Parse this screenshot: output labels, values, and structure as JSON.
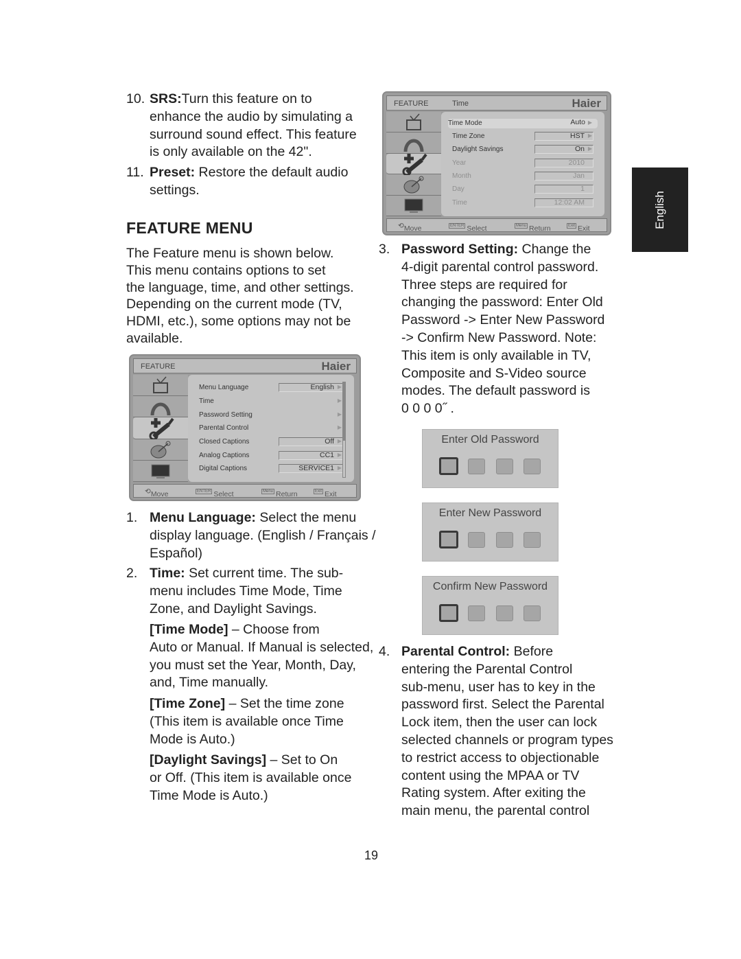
{
  "left_column": {
    "items": [
      {
        "number": "10.",
        "bold": "SRS:",
        "lines": [
          "Turn this feature on to",
          "enhance the audio by simulating a",
          "surround sound effect.  This feature",
          "is only available on the 42\"."
        ]
      },
      {
        "number": "11.",
        "bold": "Preset:",
        "lines": [
          " Restore the default audio",
          "settings."
        ]
      }
    ],
    "heading": "FEATURE MENU",
    "intro": [
      "The Feature menu is shown below.",
      "This menu contains options to set",
      "the language, time, and other settings.",
      "Depending on the current mode (TV,",
      "HDMI, etc.), some options may not be",
      "available."
    ],
    "numbered": [
      {
        "number": "1.",
        "bold": "Menu Language:",
        "lines": [
          " Select the menu",
          "display language. (English / Français /",
          "Español)"
        ]
      },
      {
        "number": "2.",
        "bold": "Time:",
        "lines": [
          " Set current time. The sub-",
          "menu includes Time Mode, Time",
          "Zone, and Daylight Savings."
        ]
      }
    ],
    "sub_items": [
      {
        "bold": "[Time Mode]",
        "lines": [
          " – Choose from",
          "Auto or Manual. If Manual is selected,",
          "you must set the Year, Month, Day,",
          "and, Time manually."
        ]
      },
      {
        "bold": "[Time Zone]",
        "lines": [
          " – Set the time zone",
          "(This item is available once Time",
          "Mode is Auto.)"
        ]
      },
      {
        "bold": "[Daylight Savings]",
        "lines": [
          " – Set to On",
          "or Off. (This item is available once",
          "Time Mode is Auto.)"
        ]
      }
    ]
  },
  "right_column": {
    "numbered": [
      {
        "number": "3.",
        "bold": "Password Setting:",
        "lines": [
          " Change the",
          "4-digit parental control password.",
          "Three steps are required for",
          "changing the password: Enter Old",
          "Password -> Enter New Password",
          "-> Confirm New Password. Note:",
          "This item is only available in TV,",
          "Composite and S-Video source",
          "modes. The default password is",
          "   0 0 0 0˝ ."
        ]
      },
      {
        "number": "4.",
        "bold": "Parental Control:",
        "lines": [
          " Before",
          "entering the Parental Control",
          "sub-menu, user has to key in the",
          "password first. Select the Parental",
          "Lock item, then the user can lock",
          "selected channels or program types",
          "to restrict access to objectionable",
          "content using the MPAA or TV",
          "Rating system.  After exiting the",
          "main menu, the parental control"
        ]
      }
    ],
    "password_dialogs": [
      "Enter Old Password",
      "Enter New Password",
      "Confirm New Password"
    ]
  },
  "feature_menu": {
    "title": "FEATURE",
    "subtitle": "",
    "logo": "Haier",
    "icons": [
      "tv-antenna-icon",
      "sound-arc-icon",
      "wrench-icon",
      "satellite-dish-icon",
      "screen-icon"
    ],
    "selected_icon": 2,
    "rows": [
      {
        "label": "Menu Language",
        "value": "English",
        "box": true,
        "arrow": true
      },
      {
        "label": "Time",
        "value": "",
        "box": false,
        "arrow": true
      },
      {
        "label": "Password Setting",
        "value": "",
        "box": false,
        "arrow": true
      },
      {
        "label": "Parental Control",
        "value": "",
        "box": false,
        "arrow": true
      },
      {
        "label": "Closed Captions",
        "value": "Off",
        "box": true,
        "arrow": true
      },
      {
        "label": "Analog Captions",
        "value": "CC1",
        "box": true,
        "arrow": true
      },
      {
        "label": "Digital Captions",
        "value": "SERVICE1",
        "box": true,
        "arrow": true
      }
    ],
    "footer": [
      {
        "key": "",
        "label": "Move"
      },
      {
        "key": "ENTER",
        "label": "Select"
      },
      {
        "key": "Menu",
        "label": "Return"
      },
      {
        "key": "Exit",
        "label": "Exit"
      }
    ]
  },
  "time_menu": {
    "title": "FEATURE",
    "subtitle": "Time",
    "logo": "Haier",
    "icons": [
      "tv-antenna-icon",
      "sound-arc-icon",
      "wrench-icon",
      "satellite-dish-icon",
      "screen-icon"
    ],
    "selected_icon": 2,
    "rows": [
      {
        "label": "Time Mode",
        "value": "Auto",
        "box": false,
        "arrow": true,
        "highlight": true
      },
      {
        "label": "Time Zone",
        "value": "HST",
        "box": true,
        "arrow": true
      },
      {
        "label": "Daylight Savings",
        "value": "On",
        "box": true,
        "arrow": true
      },
      {
        "label": "Year",
        "value": "2010",
        "box": true,
        "disabled": true
      },
      {
        "label": "Month",
        "value": "Jan",
        "box": true,
        "disabled": true
      },
      {
        "label": "Day",
        "value": "1",
        "box": true,
        "disabled": true
      },
      {
        "label": "Time",
        "value": "12:02 AM",
        "box": true,
        "disabled": true
      }
    ],
    "footer": [
      {
        "key": "",
        "label": "Move"
      },
      {
        "key": "ENTER",
        "label": "Select"
      },
      {
        "key": "Menu",
        "label": "Return"
      },
      {
        "key": "Exit",
        "label": "Exit"
      }
    ]
  },
  "side_tab": "English",
  "page_number": "19"
}
